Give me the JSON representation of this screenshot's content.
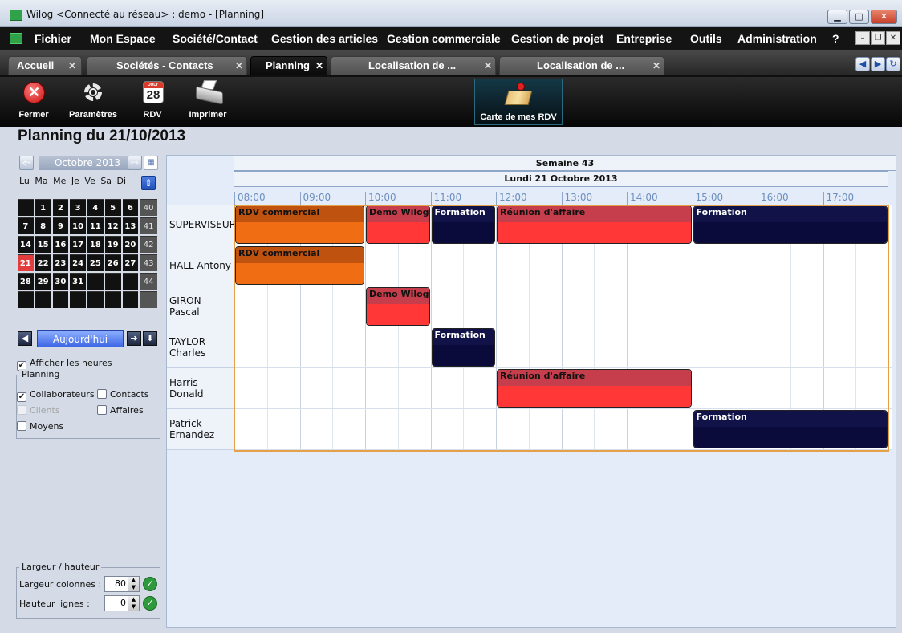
{
  "window": {
    "title": "Wilog <Connecté au réseau> : demo - [Planning]"
  },
  "menu": [
    "Fichier",
    "Mon Espace",
    "Société/Contact",
    "Gestion des articles",
    "Gestion commerciale",
    "Gestion de projet",
    "Entreprise",
    "Outils",
    "Administration",
    "?"
  ],
  "tabs": [
    {
      "label": "Accueil",
      "active": false
    },
    {
      "label": "Sociétés - Contacts",
      "active": false
    },
    {
      "label": "Planning",
      "active": true
    },
    {
      "label": "Localisation de ...",
      "active": false
    },
    {
      "label": "Localisation de ...",
      "active": false
    }
  ],
  "toolbar": {
    "close": "Fermer",
    "settings": "Paramètres",
    "rdv": "RDV",
    "rdv_day": "28",
    "print": "Imprimer",
    "map": "Carte de mes RDV"
  },
  "page_title": "Planning du 21/10/2013",
  "calendar": {
    "month": "Octobre 2013",
    "dow": "Lu Ma Me Je Ve Sa Di",
    "weeks": [
      {
        "days": [
          "",
          "1",
          "2",
          "3",
          "4",
          "5",
          "6"
        ],
        "wk": "40"
      },
      {
        "days": [
          "7",
          "8",
          "9",
          "10",
          "11",
          "12",
          "13"
        ],
        "wk": "41"
      },
      {
        "days": [
          "14",
          "15",
          "16",
          "17",
          "18",
          "19",
          "20"
        ],
        "wk": "42"
      },
      {
        "days": [
          "21",
          "22",
          "23",
          "24",
          "25",
          "26",
          "27"
        ],
        "wk": "43"
      },
      {
        "days": [
          "28",
          "29",
          "30",
          "31",
          "",
          "",
          ""
        ],
        "wk": "44"
      },
      {
        "days": [
          "",
          "",
          "",
          "",
          "",
          "",
          ""
        ],
        "wk": ""
      }
    ],
    "today_label": "Aujourd'hui"
  },
  "options": {
    "show_hours": "Afficher les heures",
    "planning_group": "Planning",
    "collaborateurs": "Collaborateurs",
    "contacts": "Contacts",
    "clients": "Clients",
    "affaires": "Affaires",
    "moyens": "Moyens"
  },
  "size": {
    "group": "Largeur / hauteur",
    "width_label": "Largeur colonnes :",
    "width_value": "80",
    "height_label": "Hauteur lignes :",
    "height_value": "0"
  },
  "planning": {
    "week": "Semaine 43",
    "day": "Lundi 21 Octobre 2013",
    "hours": [
      "08:00",
      "09:00",
      "10:00",
      "11:00",
      "12:00",
      "13:00",
      "14:00",
      "15:00",
      "16:00",
      "17:00"
    ],
    "rows": [
      {
        "name": "SUPERVISEUR",
        "events": [
          {
            "title": "RDV commercial",
            "color": "orange",
            "start": 8.0,
            "end": 10.0
          },
          {
            "title": "Demo Wilog",
            "color": "red",
            "start": 10.0,
            "end": 11.0
          },
          {
            "title": "Formation",
            "color": "navy",
            "start": 11.0,
            "end": 12.0
          },
          {
            "title": "Réunion d'affaire",
            "color": "red",
            "start": 12.0,
            "end": 15.0
          },
          {
            "title": "Formation",
            "color": "navy",
            "start": 15.0,
            "end": 18.0
          }
        ]
      },
      {
        "name": "HALL Antony",
        "events": [
          {
            "title": "RDV commercial",
            "color": "orange",
            "start": 8.0,
            "end": 10.0
          }
        ]
      },
      {
        "name": "GIRON Pascal",
        "events": [
          {
            "title": "Demo Wilog",
            "color": "red",
            "start": 10.0,
            "end": 11.0
          }
        ]
      },
      {
        "name": "TAYLOR Charles",
        "events": [
          {
            "title": "Formation",
            "color": "navy",
            "start": 11.0,
            "end": 12.0
          }
        ]
      },
      {
        "name": "Harris Donald",
        "events": [
          {
            "title": "Réunion d'affaire",
            "color": "red",
            "start": 12.0,
            "end": 15.0
          }
        ]
      },
      {
        "name": "Patrick Ernandez",
        "events": [
          {
            "title": "Formation",
            "color": "navy",
            "start": 15.0,
            "end": 18.0
          }
        ]
      }
    ]
  }
}
